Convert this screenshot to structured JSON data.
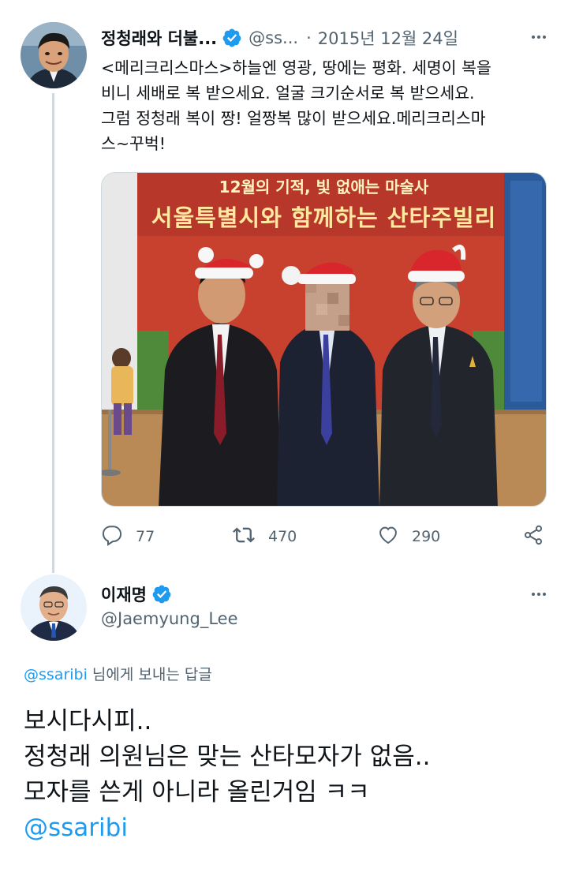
{
  "tweet1": {
    "author_name": "정청래와 더불...",
    "handle": "@ss...",
    "separator": "·",
    "date": "2015년 12월 24일",
    "text": "<메리크리스마스>하늘엔 영광, 땅에는 평화. 세명이 복을\n비니 세배로 복 받으세요. 얼굴 크기순서로 복 받으세요.\n그럼 정청래 복이 짱! 얼짱복 많이 받으세요.메리크리스마\n스~꾸벅!",
    "media": {
      "banner_line1": "12월의 기적, 빛 없애는 마술사",
      "banner_line2": "서울특별시와 함께하는 산타주빌리"
    },
    "stats": {
      "replies": "77",
      "retweets": "470",
      "likes": "290"
    }
  },
  "tweet2": {
    "author_name": "이재명",
    "handle": "@Jaemyung_Lee",
    "replying_to_handle": "@ssaribi",
    "replying_to_suffix": " 님에게 보내는 답글",
    "lines": [
      "보시다시피..",
      "정청래 의원님은 맞는 산타모자가 없음..",
      "모자를 쓴게 아니라 올린거임 ㅋㅋ"
    ],
    "mention": "@ssaribi"
  },
  "colors": {
    "accent": "#1d9bf0",
    "secondary_text": "#536471",
    "thread_line": "#cfd9de"
  },
  "icons": {
    "reply": "reply-icon",
    "retweet": "retweet-icon",
    "like": "heart-icon",
    "share": "share-icon",
    "more": "more-icon",
    "verified": "verified-badge-icon"
  }
}
